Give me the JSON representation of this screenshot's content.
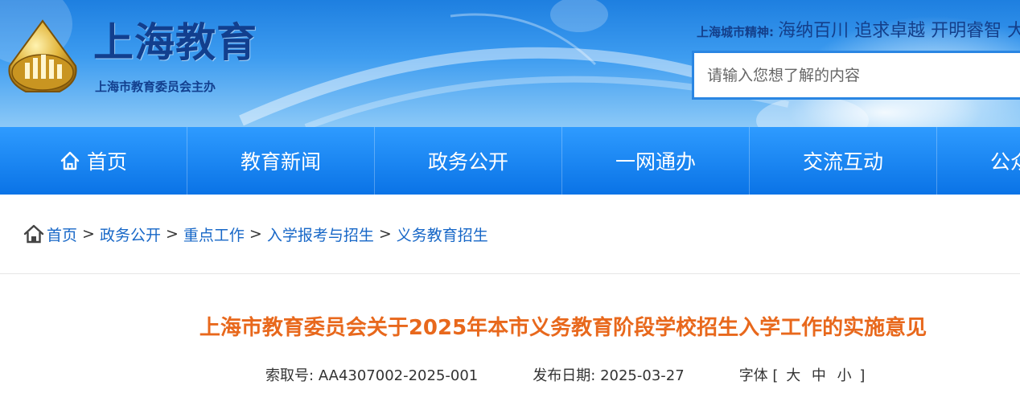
{
  "header": {
    "site_title": "上海教育",
    "site_subtitle": "上海市教育委员会主办",
    "motto_label": "上海城市精神:",
    "motto_text": "海纳百川 追求卓越 开明睿智 大气谦和",
    "search_placeholder": "请输入您想了解的内容"
  },
  "nav": {
    "items": [
      {
        "label": "首页",
        "icon": "home-icon"
      },
      {
        "label": "教育新闻"
      },
      {
        "label": "政务公开"
      },
      {
        "label": "一网通办"
      },
      {
        "label": "交流互动"
      },
      {
        "label": "公众服务"
      }
    ]
  },
  "breadcrumb": {
    "icon": "home-icon",
    "items": [
      "首页",
      "政务公开",
      "重点工作",
      "入学报考与招生",
      "义务教育招生"
    ],
    "separator": ">"
  },
  "article": {
    "title": "上海市教育委员会关于2025年本市义务教育阶段学校招生入学工作的实施意见",
    "index_label": "索取号:",
    "index_value": "AA4307002-2025-001",
    "date_label": "发布日期:",
    "date_value": "2025-03-27",
    "font_label": "字体",
    "font_open": "[",
    "font_large": "大",
    "font_medium": "中",
    "font_small": "小",
    "font_close": "]"
  },
  "colors": {
    "title_orange": "#e8681c",
    "nav_blue": "#0a73e6",
    "link_blue": "#1767c7",
    "brand_navy": "#123f8e"
  }
}
